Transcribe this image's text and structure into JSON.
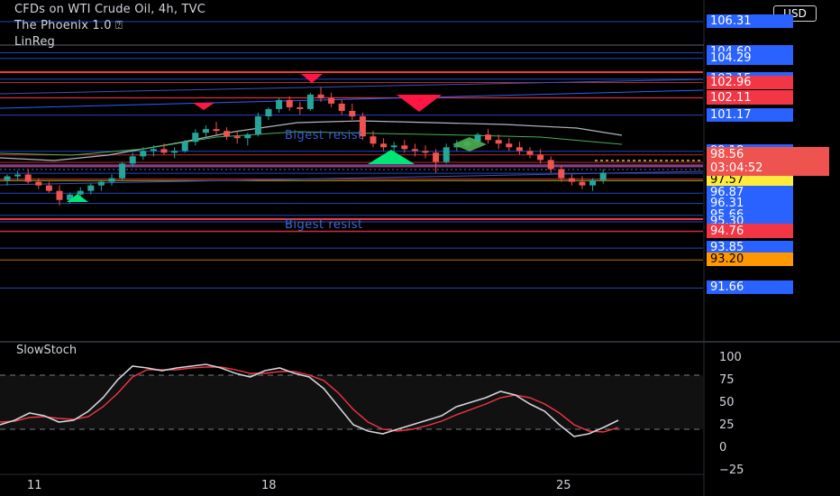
{
  "legend": {
    "symbol": "CFDs on WTI Crude Oil, 4h, TVC",
    "indicator1": "The Phoenix 1.0 ⍰",
    "indicator2": "LinReg"
  },
  "currency_button": "USD",
  "price_labels": [
    {
      "text": "106.31",
      "bg": "#2962ff",
      "fg": "#ffffff"
    },
    {
      "text": "104.60",
      "bg": "#2962ff",
      "fg": "#ffffff"
    },
    {
      "text": "104.29",
      "bg": "#2962ff",
      "fg": "#ffffff"
    },
    {
      "text": "103.15",
      "bg": "#2962ff",
      "fg": "#ffffff"
    },
    {
      "text": "102.96",
      "bg": "#f23645",
      "fg": "#ffffff"
    },
    {
      "text": "102.13",
      "bg": "#f23645",
      "fg": "#ffffff"
    },
    {
      "text": "102.11",
      "bg": "#f23645",
      "fg": "#ffffff"
    },
    {
      "text": "101.17",
      "bg": "#2962ff",
      "fg": "#ffffff"
    },
    {
      "text": "99.18",
      "bg": "#2962ff",
      "fg": "#ffffff"
    },
    {
      "text": "98.98",
      "bg": "#f23645",
      "fg": "#ffffff"
    },
    {
      "text": "98.57",
      "bg": "#f23645",
      "fg": "#ffffff"
    },
    {
      "text": "98.44",
      "bg": "#2962ff",
      "fg": "#ffffff"
    },
    {
      "text": "98.32",
      "bg": "#2962ff",
      "fg": "#ffffff"
    },
    {
      "text": "97.97",
      "bg": "#2962ff",
      "fg": "#ffffff"
    },
    {
      "text": "97.66",
      "bg": "#f23645",
      "fg": "#ffffff"
    },
    {
      "text": "97.57",
      "bg": "#ffeb3b",
      "fg": "#000000"
    },
    {
      "text": "96.87",
      "bg": "#2962ff",
      "fg": "#ffffff"
    },
    {
      "text": "96.31",
      "bg": "#2962ff",
      "fg": "#ffffff"
    },
    {
      "text": "95.66",
      "bg": "#2962ff",
      "fg": "#ffffff"
    },
    {
      "text": "95.30",
      "bg": "#2962ff",
      "fg": "#ffffff"
    },
    {
      "text": "94.79",
      "bg": "#f23645",
      "fg": "#ffffff"
    },
    {
      "text": "94.76",
      "bg": "#f23645",
      "fg": "#ffffff"
    },
    {
      "text": "93.85",
      "bg": "#2962ff",
      "fg": "#ffffff"
    },
    {
      "text": "93.20",
      "bg": "#ff9800",
      "fg": "#000000"
    },
    {
      "text": "91.66",
      "bg": "#2962ff",
      "fg": "#ffffff"
    }
  ],
  "last_price": {
    "price": "98.56",
    "countdown": "03:04:52"
  },
  "annotation_text": [
    "Bigest resist",
    "Bigest resist"
  ],
  "oscillator": {
    "label": "SlowStoch",
    "ticks": [
      "100",
      "75",
      "50",
      "25",
      "0",
      "−25"
    ]
  },
  "x_ticks": [
    "11",
    "18",
    "25"
  ],
  "colors": {
    "up": "#26a69a",
    "down": "#ef5350",
    "resist_red": "#f23645",
    "resist_blue": "#2962ff",
    "stoch_k": "#d1d4dc",
    "stoch_d": "#f23645",
    "signal_green": "#00e676",
    "signal_red": "#ff1744"
  },
  "chart_data": {
    "type": "candlestick",
    "price_range": [
      88.75,
      107.5
    ],
    "x_labels": [
      "11",
      "18",
      "25"
    ],
    "candles": [
      [
        97.6,
        97.9,
        97.3,
        97.8
      ],
      [
        97.8,
        98.1,
        97.6,
        97.9
      ],
      [
        97.9,
        98.2,
        97.4,
        97.5
      ],
      [
        97.5,
        97.7,
        97.1,
        97.3
      ],
      [
        97.3,
        97.5,
        96.9,
        97.0
      ],
      [
        97.0,
        97.3,
        96.2,
        96.5
      ],
      [
        96.5,
        96.9,
        96.3,
        96.8
      ],
      [
        96.8,
        97.2,
        96.6,
        97.0
      ],
      [
        97.0,
        97.4,
        96.8,
        97.3
      ],
      [
        97.3,
        97.6,
        97.0,
        97.5
      ],
      [
        97.5,
        97.9,
        97.3,
        97.7
      ],
      [
        97.7,
        98.6,
        97.6,
        98.5
      ],
      [
        98.5,
        99.1,
        98.3,
        98.9
      ],
      [
        98.9,
        99.4,
        98.7,
        99.2
      ],
      [
        99.2,
        99.5,
        98.9,
        99.3
      ],
      [
        99.3,
        99.6,
        99.0,
        99.1
      ],
      [
        99.1,
        99.4,
        98.8,
        99.2
      ],
      [
        99.2,
        99.8,
        99.1,
        99.7
      ],
      [
        99.7,
        100.4,
        99.5,
        100.2
      ],
      [
        100.2,
        100.6,
        99.9,
        100.4
      ],
      [
        100.4,
        100.8,
        100.1,
        100.3
      ],
      [
        100.3,
        100.5,
        99.8,
        100.0
      ],
      [
        100.0,
        100.3,
        99.6,
        99.9
      ],
      [
        99.9,
        100.2,
        99.5,
        100.1
      ],
      [
        100.1,
        101.3,
        100.0,
        101.1
      ],
      [
        101.1,
        101.6,
        100.9,
        101.5
      ],
      [
        101.5,
        102.1,
        101.3,
        102.0
      ],
      [
        102.0,
        102.2,
        101.4,
        101.6
      ],
      [
        101.6,
        101.9,
        101.2,
        101.5
      ],
      [
        101.5,
        102.4,
        101.4,
        102.3
      ],
      [
        102.3,
        102.7,
        101.9,
        102.1
      ],
      [
        102.1,
        102.4,
        101.6,
        101.8
      ],
      [
        101.8,
        102.0,
        101.2,
        101.4
      ],
      [
        101.4,
        101.8,
        100.9,
        101.1
      ],
      [
        101.1,
        101.3,
        99.8,
        100.0
      ],
      [
        100.0,
        100.3,
        99.4,
        99.6
      ],
      [
        99.6,
        99.9,
        99.2,
        99.4
      ],
      [
        99.4,
        99.7,
        99.0,
        99.5
      ],
      [
        99.5,
        99.8,
        99.1,
        99.3
      ],
      [
        99.3,
        99.6,
        98.9,
        99.2
      ],
      [
        99.2,
        99.5,
        98.8,
        99.1
      ],
      [
        99.1,
        99.3,
        98.0,
        98.6
      ],
      [
        98.6,
        99.6,
        98.5,
        99.4
      ],
      [
        99.4,
        99.8,
        99.2,
        99.5
      ],
      [
        99.5,
        99.9,
        99.3,
        99.7
      ],
      [
        99.7,
        100.2,
        99.5,
        100.1
      ],
      [
        100.1,
        100.4,
        99.6,
        99.8
      ],
      [
        99.8,
        100.1,
        99.3,
        99.6
      ],
      [
        99.6,
        99.9,
        99.2,
        99.4
      ],
      [
        99.4,
        99.7,
        99.0,
        99.2
      ],
      [
        99.2,
        99.4,
        98.8,
        99.0
      ],
      [
        99.0,
        99.3,
        98.5,
        98.7
      ],
      [
        98.7,
        98.9,
        98.0,
        98.2
      ],
      [
        98.2,
        98.4,
        97.5,
        97.7
      ],
      [
        97.7,
        97.9,
        97.3,
        97.5
      ],
      [
        97.5,
        97.8,
        97.1,
        97.3
      ],
      [
        97.3,
        97.7,
        97.0,
        97.6
      ],
      [
        97.6,
        98.2,
        97.4,
        98.0
      ]
    ],
    "stoch_k": [
      25,
      30,
      38,
      35,
      28,
      30,
      40,
      55,
      75,
      90,
      88,
      85,
      88,
      90,
      92,
      88,
      82,
      78,
      85,
      88,
      82,
      78,
      65,
      45,
      25,
      18,
      15,
      20,
      25,
      30,
      35,
      45,
      50,
      55,
      62,
      58,
      48,
      40,
      25,
      12,
      15,
      22,
      30
    ],
    "stoch_d": [
      28,
      29,
      33,
      34,
      32,
      31,
      34,
      45,
      60,
      78,
      86,
      86,
      86,
      88,
      89,
      89,
      86,
      82,
      82,
      84,
      84,
      80,
      74,
      60,
      42,
      28,
      20,
      18,
      20,
      24,
      29,
      36,
      42,
      48,
      55,
      58,
      55,
      48,
      38,
      25,
      18,
      17,
      22
    ],
    "stoch_range": [
      -25,
      100
    ]
  }
}
